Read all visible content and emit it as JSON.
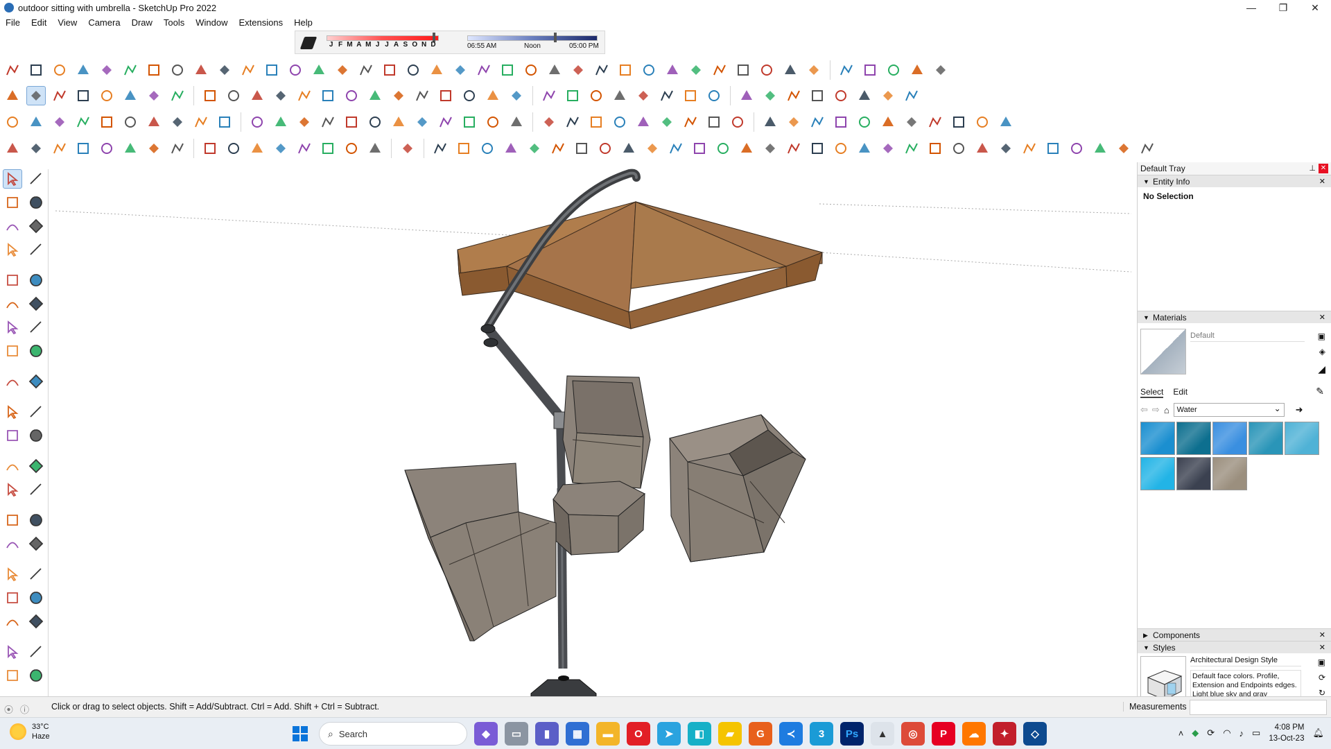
{
  "window": {
    "title": "outdoor sitting with umbrella - SketchUp Pro 2022",
    "min_label": "—",
    "max_label": "❐",
    "close_label": "✕"
  },
  "menu": [
    "File",
    "Edit",
    "View",
    "Camera",
    "Draw",
    "Tools",
    "Window",
    "Extensions",
    "Help"
  ],
  "shadow": {
    "months": [
      "J",
      "F",
      "M",
      "A",
      "M",
      "J",
      "J",
      "A",
      "S",
      "O",
      "N",
      "D"
    ],
    "time_start": "06:55 AM",
    "time_mid": "Noon",
    "time_end": "05:00 PM"
  },
  "tray": {
    "title": "Default Tray",
    "entity_info": {
      "title": "Entity Info",
      "selection": "No Selection"
    },
    "materials": {
      "title": "Materials",
      "current": "Default",
      "tab_select": "Select",
      "tab_edit": "Edit",
      "collection": "Water",
      "swatch_colors": [
        "#1b8fd0",
        "#0d6f8f",
        "#3a8fe0",
        "#2a95b8",
        "#4fb2d6",
        "#22b4e6",
        "#3b4150",
        "#9b8f7e"
      ]
    },
    "components": {
      "title": "Components"
    },
    "styles": {
      "title": "Styles",
      "name": "Architectural Design Style",
      "description": "Default face colors. Profile, Extension and Endpoints edges. Light blue sky and gray background."
    }
  },
  "status": {
    "hint": "Click or drag to select objects. Shift = Add/Subtract. Ctrl = Add. Shift + Ctrl = Subtract.",
    "measurements_label": "Measurements"
  },
  "taskbar": {
    "weather_temp": "33°C",
    "weather_desc": "Haze",
    "search_label": "Search",
    "time": "4:08 PM",
    "date": "13-Oct-23"
  },
  "colors": {
    "umbrella_top": "#a9794b",
    "umbrella_side": "#8a5a30",
    "furniture": "#8a8178",
    "furniture_dark": "#6f675f",
    "pole": "#4d4f52",
    "accent_select": "#cfe3f7"
  }
}
